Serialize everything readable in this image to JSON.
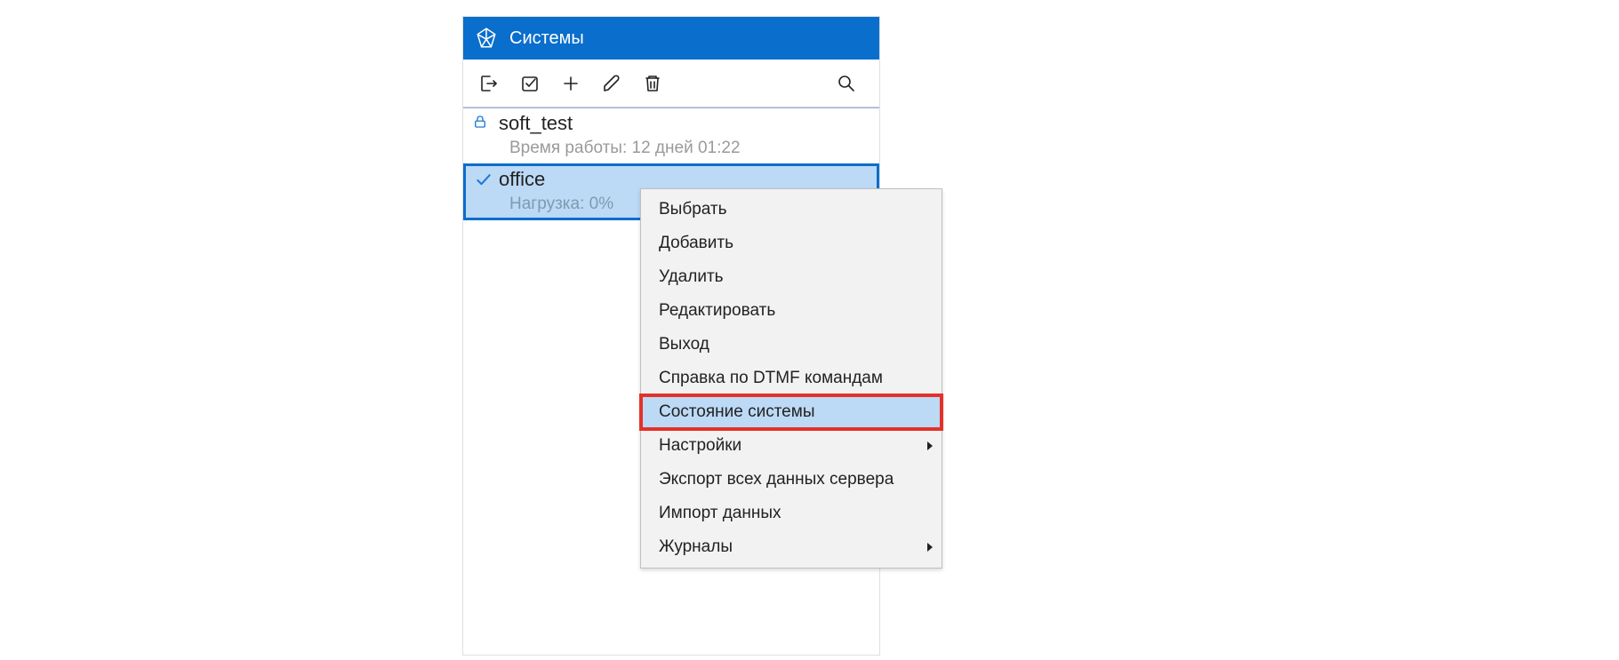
{
  "panel": {
    "title": "Системы"
  },
  "toolbar": {
    "exit": "exit",
    "select": "select",
    "add": "add",
    "edit": "edit",
    "delete": "delete",
    "search": "search"
  },
  "items": [
    {
      "name": "soft_test",
      "status": "Время работы: 12 дней 01:22",
      "icon": "lock",
      "selected": false
    },
    {
      "name": "office",
      "status": "Нагрузка: 0%",
      "icon": "check",
      "selected": true
    }
  ],
  "context_menu": {
    "items": [
      {
        "label": "Выбрать",
        "submenu": false,
        "highlighted": false
      },
      {
        "label": "Добавить",
        "submenu": false,
        "highlighted": false
      },
      {
        "label": "Удалить",
        "submenu": false,
        "highlighted": false
      },
      {
        "label": "Редактировать",
        "submenu": false,
        "highlighted": false
      },
      {
        "label": "Выход",
        "submenu": false,
        "highlighted": false
      },
      {
        "label": "Справка по DTMF командам",
        "submenu": false,
        "highlighted": false
      },
      {
        "label": "Состояние системы",
        "submenu": false,
        "highlighted": true
      },
      {
        "label": "Настройки",
        "submenu": true,
        "highlighted": false
      },
      {
        "label": "Экспорт всех данных сервера",
        "submenu": false,
        "highlighted": false
      },
      {
        "label": "Импорт данных",
        "submenu": false,
        "highlighted": false
      },
      {
        "label": "Журналы",
        "submenu": true,
        "highlighted": false
      }
    ]
  }
}
